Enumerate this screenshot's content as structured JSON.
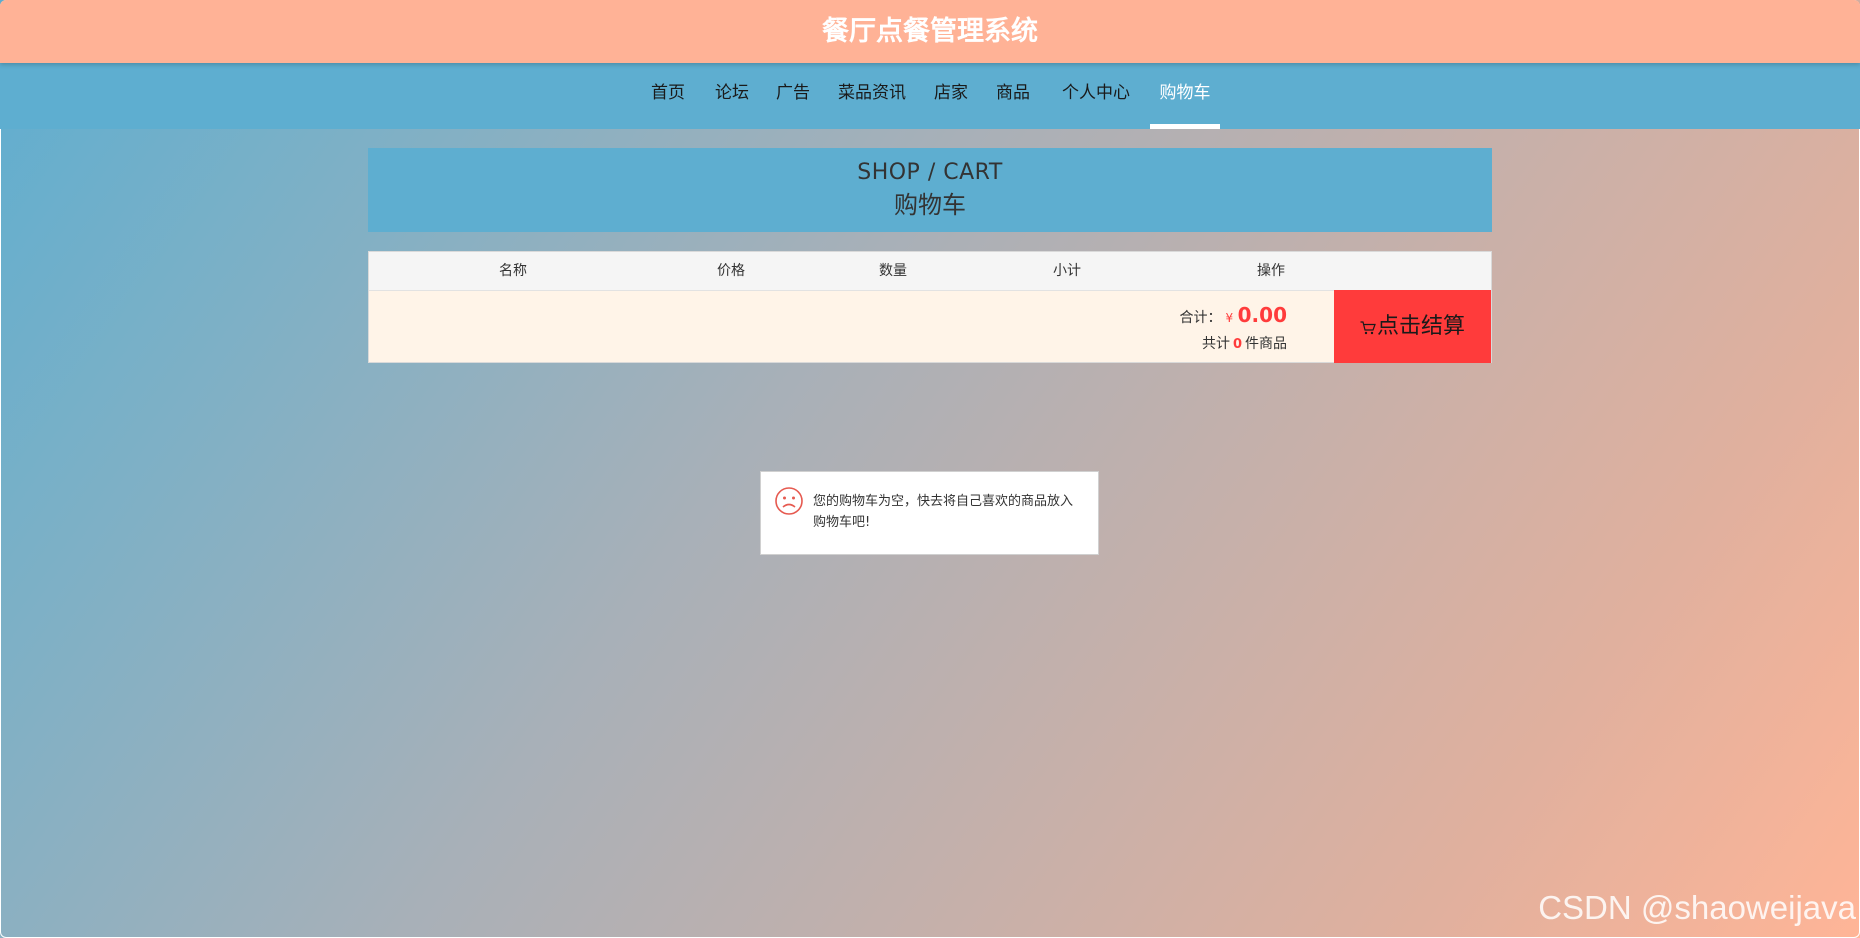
{
  "header": {
    "title": "餐厅点餐管理系统"
  },
  "nav": {
    "items": [
      {
        "label": "首页"
      },
      {
        "label": "论坛"
      },
      {
        "label": "广告"
      },
      {
        "label": "菜品资讯"
      },
      {
        "label": "店家"
      },
      {
        "label": "商品"
      },
      {
        "label": "个人中心"
      },
      {
        "label": "购物车",
        "active": true
      }
    ]
  },
  "banner": {
    "title_en": "SHOP / CART",
    "title_cn": "购物车"
  },
  "cart": {
    "columns": [
      "名称",
      "价格",
      "数量",
      "小计",
      "操作"
    ],
    "total_label": "合计：",
    "currency": "¥",
    "total_amount": "0.00",
    "count_prefix": "共计",
    "count": "0",
    "count_suffix": "件商品",
    "checkout_label": "点击结算"
  },
  "empty_message": "您的购物车为空，快去将自己喜欢的商品放入购物车吧!",
  "watermark": "CSDN @shaoweijava",
  "colors": {
    "header_bg": "#ffb296",
    "nav_bg": "#5eaed0",
    "checkout_bg": "#ff3b3b",
    "price_red": "#ff3b3b",
    "cart_row_bg": "#fff4e8"
  },
  "icons": [
    "cart-icon",
    "sad-face-icon"
  ]
}
